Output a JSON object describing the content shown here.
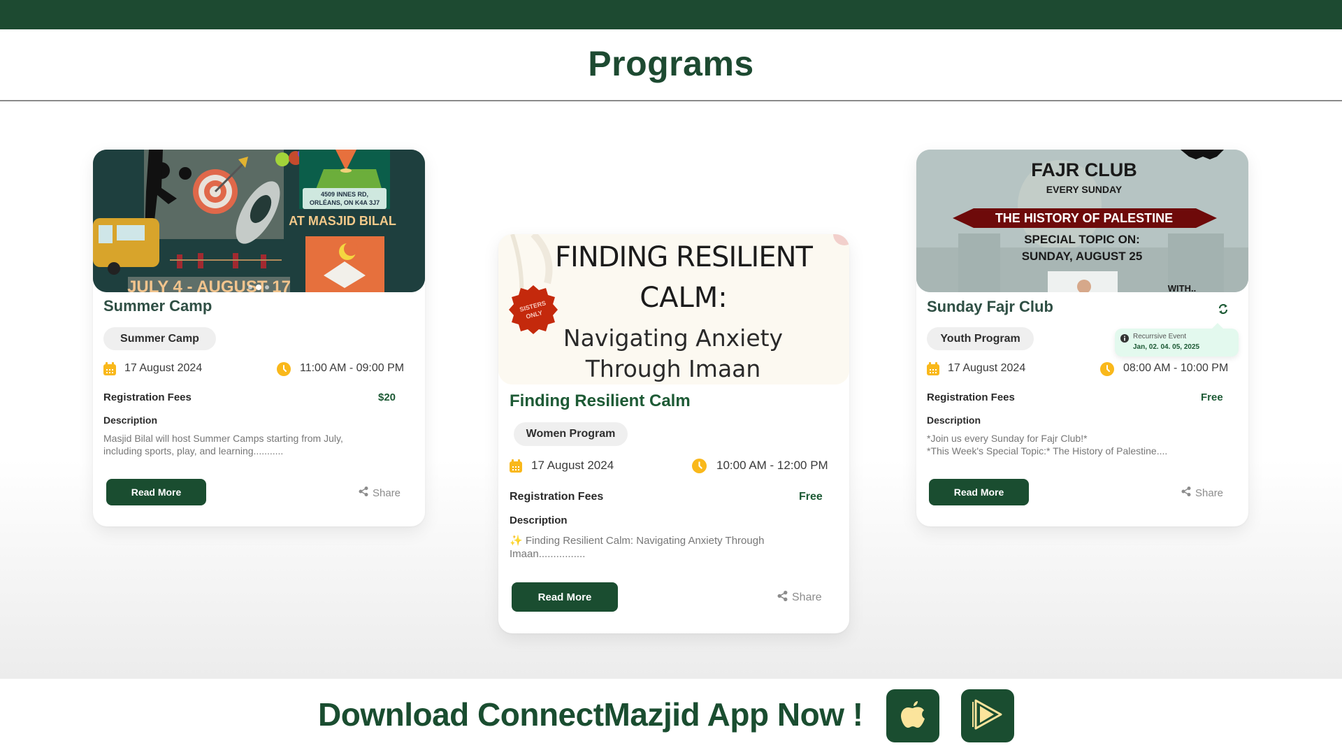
{
  "page": {
    "title": "Programs",
    "accent_color": "#1d4a31",
    "icon_color": "#f9b81b"
  },
  "programs": [
    {
      "title": "Summer Camp",
      "title_color": "#2f4f44",
      "image": {
        "alt": "Summer camp poster",
        "address_line1": "4509 INNES RD,",
        "address_line2": "ORLÉANS, ON K4A 3J7",
        "venue": "AT MASJID BILAL",
        "dates": "JULY 4 - AUGUST 17",
        "carousel_dots": 3,
        "carousel_active": 2
      },
      "category": "Summer Camp",
      "date": "17 August 2024",
      "time": "11:00 AM - 09:00 PM",
      "fees_label": "Registration Fees",
      "fees": "$20",
      "description_label": "Description",
      "description": "Masjid Bilal will host Summer Camps starting from July, including sports, play, and learning...........",
      "read_more": "Read More",
      "share": "Share"
    },
    {
      "title": "Finding Resilient Calm",
      "title_color": "#1d5a35",
      "image": {
        "alt": "Finding Resilient Calm poster",
        "line1": "FINDING RESILIENT",
        "line2": "CALM:",
        "line3": "Navigating Anxiety",
        "line4": "Through Imaan",
        "badge_line1": "SISTERS",
        "badge_line2": "ONLY"
      },
      "category": "Women Program",
      "date": "17 August 2024",
      "time": "10:00 AM - 12:00 PM",
      "fees_label": "Registration Fees",
      "fees": "Free",
      "description_label": "Description",
      "description": "✨ Finding Resilient Calm: Navigating Anxiety Through Imaan................",
      "read_more": "Read More",
      "share": "Share"
    },
    {
      "title": "Sunday Fajr Club",
      "title_color": "#2f4f44",
      "image": {
        "alt": "Fajr Club poster",
        "line1": "FAJR CLUB",
        "line2": "EVERY SUNDAY",
        "banner": "THE HISTORY OF PALESTINE",
        "line3": "SPECIAL TOPIC ON:",
        "line4": "SUNDAY, AUGUST 25",
        "line5": "WITH.."
      },
      "category": "Youth Program",
      "date": "17 August 2024",
      "time": "08:00 AM - 10:00 PM",
      "fees_label": "Registration Fees",
      "fees": "Free",
      "description_label": "Description",
      "description_line1": "*Join us every Sunday for Fajr Club!*",
      "description_line2": "*This Week's Special Topic:* The History of Palestine....",
      "read_more": "Read More",
      "share": "Share",
      "recurring": {
        "icon": "repeat-icon",
        "tooltip_title": "Recurrsive Event",
        "tooltip_dates": "Jan, 02. 04. 05, 2025"
      }
    }
  ],
  "download": {
    "text": "Download ConnectMazjid App Now !",
    "apple_icon": "apple-icon",
    "play_icon": "play-store-icon"
  }
}
